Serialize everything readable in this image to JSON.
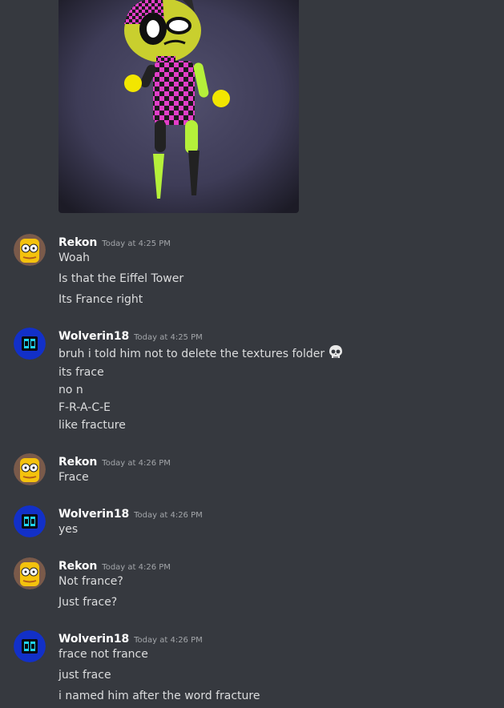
{
  "messages": [
    {
      "author": "Rekon",
      "timestamp": "Today at 4:25 PM",
      "avatar": "rekon-avatar",
      "lines": [
        "Woah",
        "Is that the Eiffel Tower",
        "Its France right"
      ]
    },
    {
      "author": "Wolverin18",
      "timestamp": "Today at 4:25 PM",
      "avatar": "wolverin-avatar",
      "lines": [
        "bruh i told him not to delete the textures folder",
        "its frace",
        "no n",
        "F-R-A-C-E",
        "like fracture"
      ],
      "emoji": "skull"
    },
    {
      "author": "Rekon",
      "timestamp": "Today at 4:26 PM",
      "avatar": "rekon-avatar",
      "lines": [
        "Frace"
      ]
    },
    {
      "author": "Wolverin18",
      "timestamp": "Today at 4:26 PM",
      "avatar": "wolverin-avatar",
      "lines": [
        "yes"
      ]
    },
    {
      "author": "Rekon",
      "timestamp": "Today at 4:26 PM",
      "avatar": "rekon-avatar",
      "lines": [
        "Not france?",
        "Just frace?"
      ]
    },
    {
      "author": "Wolverin18",
      "timestamp": "Today at 4:26 PM",
      "avatar": "wolverin-avatar",
      "lines": [
        "frace not france",
        "just frace",
        "i named him after the word fracture"
      ]
    }
  ],
  "colors": {
    "background": "#36393f",
    "username": "#ffffff",
    "timestamp": "#a3a6aa",
    "text": "#dcddde",
    "checker_pink": "#e23ec8",
    "checker_dark": "#1a1a1a",
    "lime": "#b5f03a",
    "yellow": "#f2e600"
  }
}
